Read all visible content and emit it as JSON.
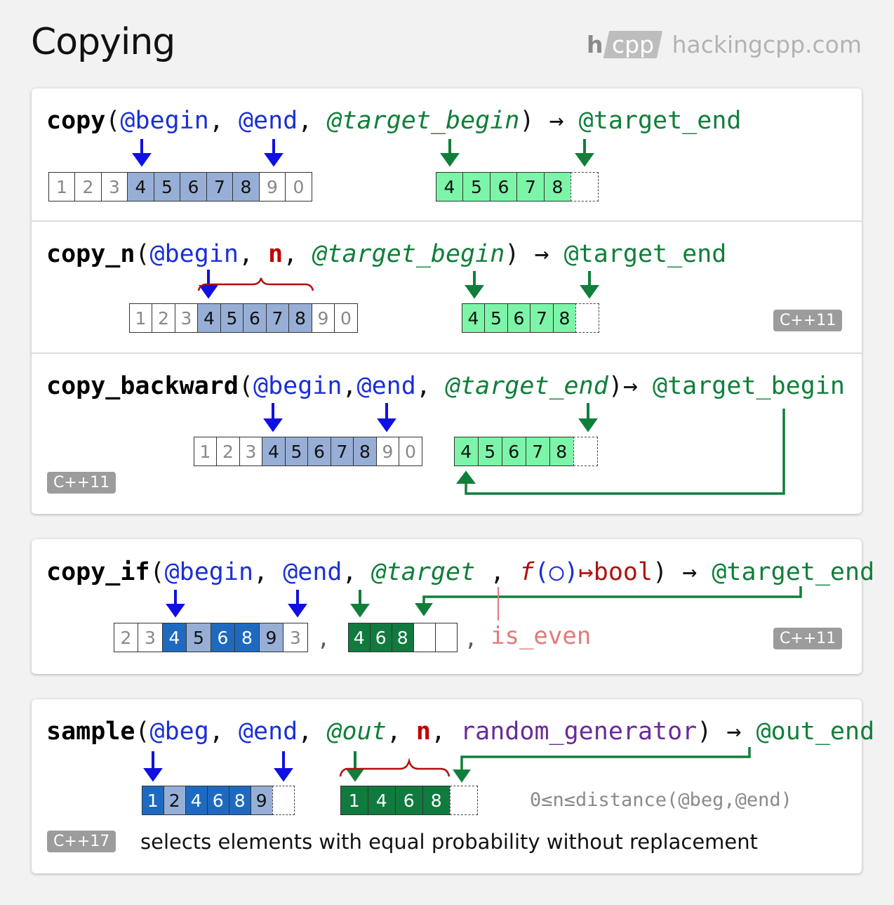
{
  "title": "Copying",
  "logo": {
    "h": "h",
    "cpp": "cpp",
    "site": "hackingcpp.com"
  },
  "copy": {
    "fn": "copy",
    "open": "(",
    "begin": "@begin",
    "c1": ", ",
    "end": "@end",
    "c2": ", ",
    "tbegin": "@target_begin",
    "close": ") ",
    "arrow": "→",
    "sp": " ",
    "result": "@target_end",
    "source": [
      "1",
      "2",
      "3",
      "4",
      "5",
      "6",
      "7",
      "8",
      "9",
      "0"
    ],
    "target": [
      "4",
      "5",
      "6",
      "7",
      "8",
      ""
    ]
  },
  "copy_n": {
    "fn": "copy_n",
    "open": "(",
    "begin": "@begin",
    "c1": ", ",
    "n": "n",
    "c2": ", ",
    "tbegin": "@target_begin",
    "close": ") ",
    "arrow": "→",
    "sp": " ",
    "result": "@target_end",
    "source": [
      "1",
      "2",
      "3",
      "4",
      "5",
      "6",
      "7",
      "8",
      "9",
      "0"
    ],
    "target": [
      "4",
      "5",
      "6",
      "7",
      "8",
      ""
    ],
    "badge": "C++11"
  },
  "copy_backward": {
    "fn": "copy_backward",
    "open": "(",
    "begin": "@begin",
    "c1": ",",
    "end": "@end",
    "c2": ", ",
    "tend": "@target_end",
    "close": ")",
    "arrow": "→",
    "sp": " ",
    "result": "@target_begin",
    "source": [
      "1",
      "2",
      "3",
      "4",
      "5",
      "6",
      "7",
      "8",
      "9",
      "0"
    ],
    "target": [
      "4",
      "5",
      "6",
      "7",
      "8",
      ""
    ],
    "badge": "C++11"
  },
  "copy_if": {
    "fn": "copy_if",
    "open": "(",
    "begin": "@begin",
    "c1": ", ",
    "end": "@end",
    "c2": ", ",
    "target": "@target",
    "c3": " , ",
    "f": "f",
    "circle": "(○)",
    "maps": "↦",
    "bool": "bool",
    "close": ") ",
    "arrow": "→",
    "sp": " ",
    "result": "@target_end",
    "source": [
      "2",
      "3",
      "4",
      "5",
      "6",
      "8",
      "9",
      "3"
    ],
    "output": [
      "4",
      "6",
      "8",
      "",
      ""
    ],
    "sep1": ",",
    "sep2": ",",
    "pred": "is_even",
    "badge": "C++11"
  },
  "sample": {
    "fn": "sample",
    "open": "(",
    "beg": "@beg",
    "c1": ", ",
    "end": "@end",
    "c2": ", ",
    "out": "@out",
    "c3": ", ",
    "n": "n",
    "c4": ", ",
    "gen": "random_generator",
    "close": ") ",
    "arrow": "→",
    "sp": " ",
    "result": "@out_end",
    "source": [
      "1",
      "2",
      "4",
      "6",
      "8",
      "9",
      ""
    ],
    "output": [
      "1",
      "4",
      "6",
      "8",
      ""
    ],
    "constraint": "0≤n≤distance(@beg,@end)",
    "badge": "C++17",
    "description": "selects elements with equal probability without replacement"
  },
  "colors": {
    "blue_arrow": "#1010e0",
    "green_arrow": "#0f7f3a",
    "brace": "#b01010",
    "selected": "#97afd6",
    "copied": "#7cf5a8"
  }
}
